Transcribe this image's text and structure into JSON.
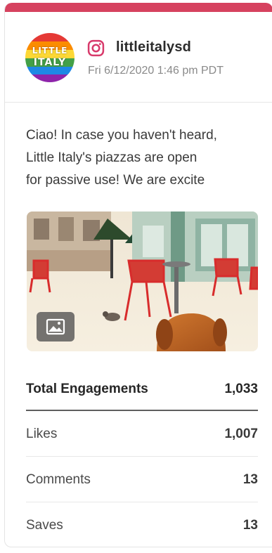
{
  "colors": {
    "accent": "#d6425f",
    "instagram": "#d83a6b"
  },
  "post": {
    "avatar_line1": "LITTLE",
    "avatar_line2": "ITALY",
    "network_icon": "instagram-icon",
    "account": "littleitalysd",
    "date": "Fri 6/12/2020 1:46 pm PDT",
    "caption_lines": [
      "Ciao! In case you haven't heard,",
      "Little Italy's piazzas are open",
      "for passive use! We are excite"
    ],
    "media_icon": "image-icon"
  },
  "stats": [
    {
      "label": "Total Engagements",
      "value": "1,033"
    },
    {
      "label": "Likes",
      "value": "1,007"
    },
    {
      "label": "Comments",
      "value": "13"
    },
    {
      "label": "Saves",
      "value": "13"
    }
  ]
}
